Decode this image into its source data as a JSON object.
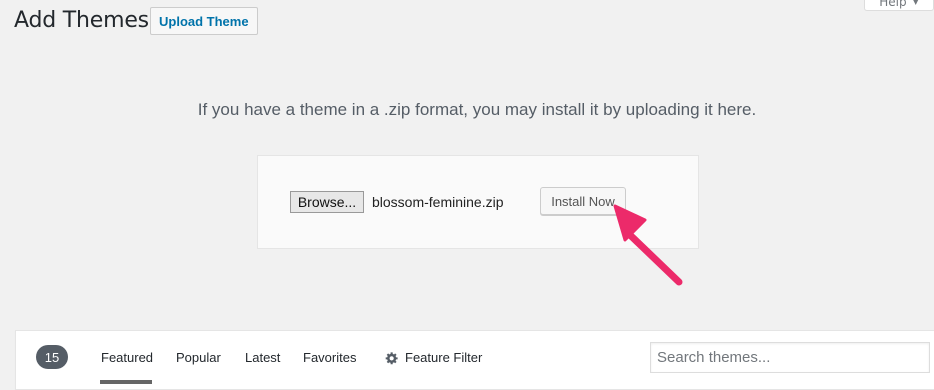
{
  "header": {
    "title": "Add Themes",
    "upload_button": "Upload Theme",
    "help_tab": "Help",
    "help_caret": "▼"
  },
  "upload": {
    "help_text": "If you have a theme in a .zip format, you may install it by uploading it here.",
    "browse_label": "Browse...",
    "file_name": "blossom-feminine.zip",
    "install_label": "Install Now"
  },
  "annotation": {
    "arrow_color": "#ec2a6a"
  },
  "filter_bar": {
    "count": "15",
    "links": [
      "Featured",
      "Popular",
      "Latest",
      "Favorites"
    ],
    "current": "Featured",
    "feature_filter_label": "Feature Filter",
    "feature_filter_icon": "gear-icon",
    "search_placeholder": "Search themes..."
  }
}
